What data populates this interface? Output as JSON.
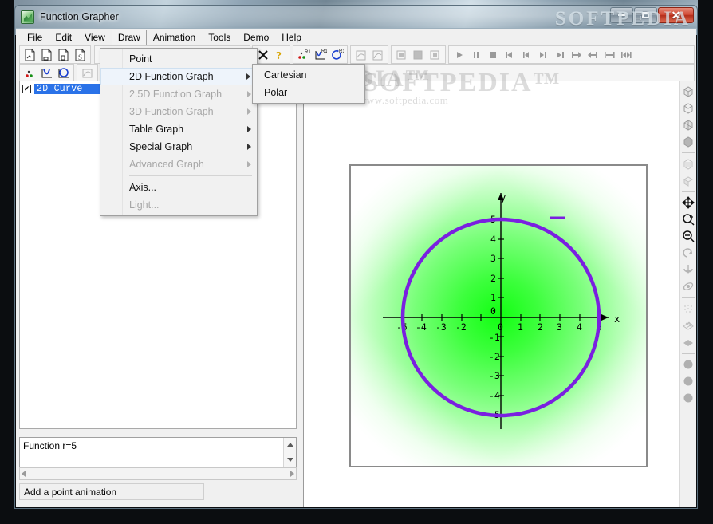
{
  "window": {
    "title": "Function Grapher",
    "app_icon": "function-grapher-icon",
    "buttons": {
      "minimize": "–",
      "maximize": "□",
      "close": "✕"
    }
  },
  "menubar": {
    "items": [
      {
        "label": "File",
        "active": false
      },
      {
        "label": "Edit",
        "active": false
      },
      {
        "label": "View",
        "active": false
      },
      {
        "label": "Draw",
        "active": true
      },
      {
        "label": "Animation",
        "active": false
      },
      {
        "label": "Tools",
        "active": false
      },
      {
        "label": "Demo",
        "active": false
      },
      {
        "label": "Help",
        "active": false
      }
    ]
  },
  "draw_menu": {
    "items": [
      {
        "label": "Point",
        "disabled": false,
        "submenu": false,
        "highlighted": false
      },
      {
        "label": "2D Function Graph",
        "disabled": false,
        "submenu": true,
        "highlighted": true
      },
      {
        "label": "2.5D Function Graph",
        "disabled": true,
        "submenu": true,
        "highlighted": false
      },
      {
        "label": "3D Function Graph",
        "disabled": true,
        "submenu": true,
        "highlighted": false
      },
      {
        "label": "Table Graph",
        "disabled": false,
        "submenu": true,
        "highlighted": false
      },
      {
        "label": "Special Graph",
        "disabled": false,
        "submenu": true,
        "highlighted": false
      },
      {
        "label": "Advanced Graph",
        "disabled": true,
        "submenu": true,
        "highlighted": false
      },
      {
        "separator": true
      },
      {
        "label": "Axis...",
        "disabled": false,
        "submenu": false,
        "highlighted": false
      },
      {
        "label": "Light...",
        "disabled": true,
        "submenu": false,
        "highlighted": false
      }
    ]
  },
  "draw_submenu": {
    "items": [
      {
        "label": "Cartesian",
        "disabled": false
      },
      {
        "label": "Polar",
        "disabled": false
      }
    ]
  },
  "toolbar_row1": {
    "file_group": [
      "new-file-icon",
      "open-file-icon",
      "copy-file-icon",
      "save-file-icon"
    ],
    "edit_group": [
      "delete-x-icon",
      "help-question-icon"
    ],
    "anim_group": [
      "point-animation-icon",
      "curve-animation-icon",
      "rotation-animation-icon"
    ],
    "anim_group2": [
      "surface-animation-icon",
      "shade-animation-icon"
    ],
    "anim_group3": [
      "solid-animation-icon",
      "solid-fill-animation-icon",
      "solid-wire-animation-icon"
    ],
    "playback": [
      "play-icon",
      "pause-icon",
      "stop-icon",
      "first-frame-icon",
      "prev-frame-icon",
      "next-frame-icon",
      "last-frame-icon",
      "step-right-icon",
      "step-left-icon",
      "loop-icon",
      "reverse-loop-icon"
    ]
  },
  "toolbar_row2": {
    "group1": [
      "point-icon",
      "curve-2d-icon",
      "circle-2d-icon"
    ],
    "group2": [
      "surface-icon"
    ],
    "group3": [
      "table-graph-icon",
      "clipboard-icon"
    ]
  },
  "tree": {
    "items": [
      {
        "checked": true,
        "label": "2D Curve   r=5",
        "selected": true
      }
    ]
  },
  "function_panel": {
    "value": "Function r=5",
    "scroll_up": "scroll-up-arrow",
    "scroll_down": "scroll-down-arrow",
    "scroll_left": "scroll-left-arrow",
    "scroll_right": "scroll-right-arrow"
  },
  "statusbar": {
    "text": "Add a point animation"
  },
  "right_toolbar": {
    "items": [
      "box-view-icon",
      "cube-view-icon",
      "cube-split-icon",
      "solid-hex-icon",
      "textured-box-icon",
      "open-box-icon",
      "move-icon",
      "zoom-in-icon",
      "zoom-out-icon",
      "undo-rotate-icon",
      "rotate-left-icon",
      "rotate-down-icon",
      "rotate-3d-icon",
      "dots-plane-icon",
      "mesh-plane-icon",
      "solid-plane-icon",
      "sphere-1-icon",
      "sphere-2-icon",
      "sphere-3-icon"
    ]
  },
  "watermark": {
    "top": "SOFTPEDIA",
    "mid": "SOFTPEDIA™",
    "mid_sub": "www.softpedia.com",
    "center": "SOFTPEDIA™",
    "center_sub": "www.softpedia.com"
  },
  "chart_data": {
    "type": "line",
    "title": "",
    "function": "r=5",
    "curve_name": "2D Curve",
    "xlabel": "x",
    "ylabel": "y",
    "xlim": [
      -6.2,
      6.2
    ],
    "ylim": [
      -6.2,
      6.2
    ],
    "x_ticks": [
      -5,
      -4,
      -3,
      -2,
      -1,
      0,
      1,
      2,
      3,
      4,
      5
    ],
    "y_ticks": [
      -5,
      -4,
      -3,
      -2,
      -1,
      0,
      1,
      2,
      3,
      4,
      5
    ],
    "x_tick_labels": [
      "-5",
      "-4",
      "-3",
      "-2",
      "",
      "0",
      "1",
      "2",
      "3",
      "4",
      "5"
    ],
    "y_tick_labels": [
      "-5",
      "-4",
      "-3",
      "-2",
      "-1",
      "0",
      "1",
      "2",
      "3",
      "4",
      "5"
    ],
    "grid": false,
    "legend": {
      "show": true,
      "entries": [
        {
          "label": "",
          "color": "#7a20e0"
        }
      ],
      "position": "top-right"
    },
    "series": [
      {
        "name": "r=5",
        "type": "circle",
        "center": [
          0,
          0
        ],
        "radius": 5,
        "color": "#7a20e0",
        "line_width": 4
      }
    ],
    "background": {
      "type": "radial-gradient",
      "center_color": "#12ff12",
      "edge_color": "#ffffff"
    },
    "axis_color": "#000000"
  },
  "colors": {
    "curve": "#7a20e0",
    "graph_center": "#12ff12",
    "selection": "#2a72e8",
    "close_button": "#cf4530"
  }
}
